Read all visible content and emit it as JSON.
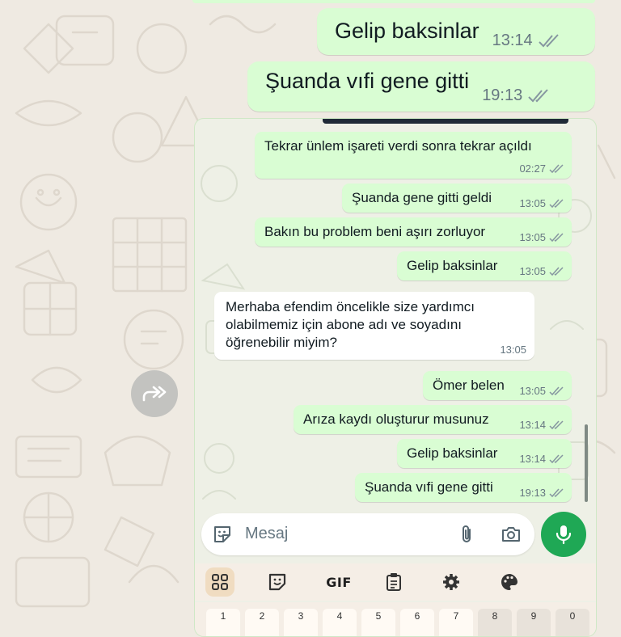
{
  "outer_chat": {
    "messages": [
      {
        "text": "Gelip baksinlar",
        "time": "13:14"
      },
      {
        "text": "Şuanda vıfi gene gitti",
        "time": "19:13"
      }
    ]
  },
  "screenshot": {
    "messages": [
      {
        "text": "Tekrar ünlem işareti verdi sonra tekrar açıldı",
        "time": "02:27",
        "outgoing": true
      },
      {
        "text": "Şuanda gene gitti geldi",
        "time": "13:05",
        "outgoing": true
      },
      {
        "text": "Bakın bu problem beni aşırı zorluyor",
        "time": "13:05",
        "outgoing": true
      },
      {
        "text": "Gelip baksinlar",
        "time": "13:05",
        "outgoing": true
      },
      {
        "text_lines": [
          "Merhaba efendim öncelikle size yardımcı",
          "olabilmemiz için abone adı ve soyadını",
          "öğrenebilir miyim?"
        ],
        "time": "13:05",
        "outgoing": false
      },
      {
        "text": "Ömer belen",
        "time": "13:05",
        "outgoing": true
      },
      {
        "text": "Arıza kaydı oluşturur musunuz",
        "time": "13:14",
        "outgoing": true
      },
      {
        "text": "Gelip baksinlar",
        "time": "13:14",
        "outgoing": true
      },
      {
        "text": "Şuanda vıfi gene gitti",
        "time": "19:13",
        "outgoing": true
      }
    ],
    "input": {
      "placeholder": "Mesaj"
    },
    "keyboard": {
      "toolbar": [
        "apps-icon",
        "sticker-icon",
        "GIF",
        "clipboard-icon",
        "settings-icon",
        "palette-icon"
      ],
      "number_keys": [
        "1",
        "2",
        "3",
        "4",
        "5",
        "6",
        "7",
        "8",
        "9",
        "0"
      ]
    }
  },
  "colors": {
    "outgoing_bubble": "#d9fdd3",
    "incoming_bubble": "#ffffff",
    "wallpaper": "#efeae2",
    "mic_button": "#1fa855",
    "ticks": "#8696a0"
  }
}
